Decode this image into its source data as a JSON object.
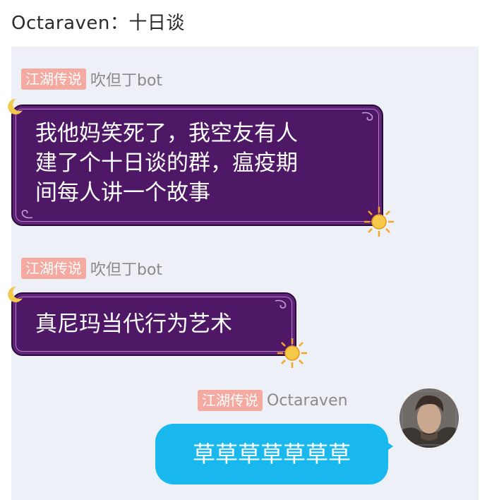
{
  "title": "Octaraven：十日谈",
  "messages": [
    {
      "tag": "江湖传说",
      "sender": "吹但丁bot",
      "lines": [
        "我他妈笑死了，我空友有人",
        "建了个十日谈的群，瘟疫期",
        "间每人讲一个故事"
      ]
    },
    {
      "tag": "江湖传说",
      "sender": "吹但丁bot",
      "lines": [
        "真尼玛当代行为艺术"
      ]
    },
    {
      "tag": "江湖传说",
      "sender": "Octaraven",
      "lines": [
        "草草草草草草草"
      ]
    }
  ],
  "colors": {
    "bot_bubble": "#4f1866",
    "user_bubble": "#19b9f0",
    "tag_bg": "#f4a9a1",
    "chat_bg": "#eef0f7"
  },
  "icons": {
    "bubble_corner_top": "crescent-moon-icon",
    "bubble_corner_bottom": "sun-icon"
  }
}
